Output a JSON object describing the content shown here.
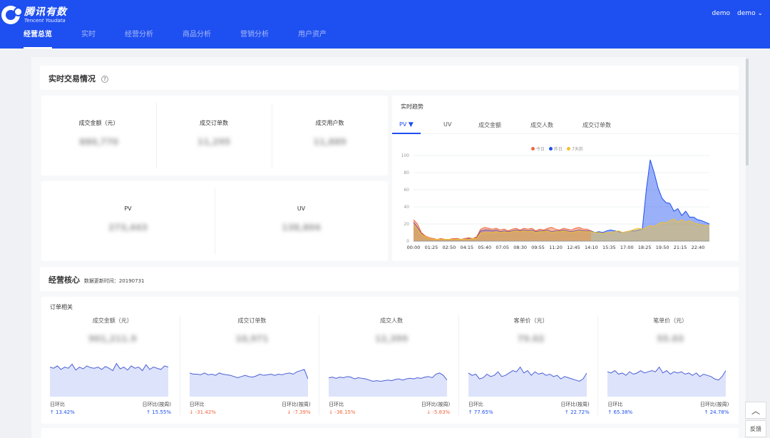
{
  "header": {
    "logo_cn": "腾讯有数",
    "logo_en": "Tencent Youdata",
    "user1": "demo",
    "user2": "demo",
    "nav": [
      "经营总览",
      "实时",
      "经营分析",
      "商品分析",
      "营销分析",
      "用户资产"
    ]
  },
  "realtime": {
    "title": "实时交易情况",
    "help": "?",
    "kpis_top": [
      {
        "label": "成交金额（元）",
        "value": "880,770"
      },
      {
        "label": "成交订单数",
        "value": "11,295"
      },
      {
        "label": "成交用户数",
        "value": "11,889"
      }
    ],
    "kpis_bottom": [
      {
        "label": "PV",
        "value": "273,443"
      },
      {
        "label": "UV",
        "value": "138,804"
      }
    ]
  },
  "trend": {
    "title": "实时趋势",
    "tabs": [
      "PV",
      "UV",
      "成交金额",
      "成交人数",
      "成交订单数"
    ],
    "legend": [
      "今日",
      "昨日",
      "7天前"
    ]
  },
  "colors": {
    "header": "#1e4ff0",
    "today": "#f0673f",
    "yesterday": "#1e4ff0",
    "week_ago": "#f2c12e",
    "up": "#1e4ff0",
    "down": "#f0673f"
  },
  "chart_data": {
    "type": "area",
    "x_ticks": [
      "00:00",
      "01:25",
      "02:50",
      "04:15",
      "05:40",
      "07:05",
      "08:30",
      "09:55",
      "11:20",
      "12:45",
      "14:10",
      "15:35",
      "17:00",
      "18:25",
      "19:50",
      "21:15",
      "22:40"
    ],
    "y_ticks": [
      0,
      20,
      40,
      60,
      80,
      100
    ],
    "ylim": [
      0,
      100
    ],
    "series": [
      {
        "name": "今日",
        "color": "#f0673f",
        "values": [
          25,
          20,
          10,
          6,
          4,
          3,
          2,
          3,
          2,
          2,
          3,
          3,
          2,
          3,
          4,
          3,
          5,
          14,
          16,
          15,
          14,
          15,
          13,
          14,
          12,
          14,
          15,
          13,
          15,
          14,
          15,
          12,
          14,
          13,
          15,
          16,
          14,
          13,
          15,
          14,
          13,
          15,
          16,
          14,
          14,
          12
        ]
      },
      {
        "name": "昨日",
        "color": "#1e4ff0",
        "values": [
          22,
          16,
          9,
          5,
          3,
          2,
          2,
          2,
          2,
          2,
          2,
          3,
          2,
          2,
          3,
          3,
          4,
          12,
          13,
          13,
          12,
          13,
          11,
          12,
          11,
          12,
          13,
          12,
          13,
          12,
          13,
          11,
          12,
          12,
          13,
          11,
          12,
          12,
          13,
          12,
          11,
          12,
          13,
          12,
          12,
          12,
          10,
          11,
          10,
          12,
          13,
          12,
          11,
          10,
          11,
          12,
          12,
          13,
          14,
          60,
          95,
          80,
          62,
          50,
          45,
          44,
          35,
          38,
          30,
          35,
          28,
          28,
          25,
          24,
          22,
          20
        ]
      },
      {
        "name": "7天前",
        "color": "#f2c12e",
        "values": [
          20,
          14,
          8,
          5,
          3,
          2,
          2,
          2,
          2,
          2,
          2,
          2,
          2,
          2,
          2,
          3,
          3,
          9,
          10,
          10,
          10,
          11,
          10,
          11,
          10,
          11,
          12,
          11,
          12,
          11,
          12,
          10,
          11,
          11,
          12,
          10,
          11,
          11,
          12,
          11,
          10,
          11,
          12,
          11,
          11,
          11,
          10,
          10,
          9,
          10,
          10,
          11,
          12,
          10,
          11,
          12,
          14,
          15,
          14,
          16,
          18,
          17,
          20,
          22,
          21,
          24,
          26,
          22,
          25,
          22,
          24,
          21,
          20,
          19,
          18,
          18
        ]
      }
    ]
  },
  "core": {
    "title": "经营核心",
    "update_label": "数据更新时间：",
    "update_date": "20190731"
  },
  "orders": {
    "title": "订单相关",
    "cards": [
      {
        "title": "成交金额（元）",
        "value": "901,211.9",
        "dod_label": "日环比",
        "dod": "13.42%",
        "dod_dir": "up",
        "wow_label": "日环比(按周)",
        "wow": "15.55%",
        "wow_dir": "up",
        "spark": [
          50,
          48,
          52,
          46,
          50,
          48,
          55,
          45,
          50,
          47,
          52,
          49,
          48,
          50,
          46,
          51,
          48,
          44,
          56,
          47,
          50,
          45,
          52,
          48,
          50,
          44,
          54,
          46,
          50,
          48,
          46,
          52,
          50
        ]
      },
      {
        "title": "成交订单数",
        "value": "10,971",
        "dod_label": "日环比",
        "dod": "-31.42%",
        "dod_dir": "down",
        "wow_label": "日环比(按周)",
        "wow": "-7.39%",
        "wow_dir": "down",
        "spark": [
          40,
          38,
          38,
          37,
          40,
          37,
          38,
          36,
          40,
          38,
          37,
          36,
          34,
          32,
          34,
          36,
          34,
          33,
          35,
          38,
          36,
          37,
          38,
          36,
          38,
          37,
          39,
          40,
          38,
          42,
          44,
          46,
          30
        ]
      },
      {
        "title": "成交人数",
        "value": "12,399",
        "dod_label": "日环比",
        "dod": "-36.15%",
        "dod_dir": "down",
        "wow_label": "日环比(按周)",
        "wow": "-5.83%",
        "wow_dir": "down",
        "spark": [
          32,
          33,
          31,
          33,
          32,
          34,
          33,
          30,
          32,
          31,
          30,
          28,
          26,
          27,
          26,
          27,
          28,
          27,
          29,
          30,
          28,
          30,
          31,
          30,
          32,
          31,
          33,
          34,
          32,
          38,
          40,
          36,
          28
        ]
      },
      {
        "title": "客单价（元）",
        "value": "79.02",
        "dod_label": "日环比",
        "dod": "77.65%",
        "dod_dir": "up",
        "wow_label": "日环比(按周)",
        "wow": "22.72%",
        "wow_dir": "up",
        "spark": [
          40,
          36,
          38,
          30,
          32,
          38,
          34,
          36,
          42,
          34,
          36,
          40,
          44,
          42,
          50,
          40,
          44,
          36,
          42,
          38,
          40,
          36,
          38,
          34,
          36,
          30,
          34,
          32,
          30,
          28,
          26,
          30,
          40
        ]
      },
      {
        "title": "笔单价（元）",
        "value": "55.03",
        "dod_label": "日环比",
        "dod": "65.38%",
        "dod_dir": "up",
        "wow_label": "日环比(按周)",
        "wow": "24.78%",
        "wow_dir": "up",
        "spark": [
          42,
          40,
          44,
          38,
          40,
          36,
          42,
          38,
          40,
          44,
          40,
          42,
          44,
          42,
          50,
          40,
          44,
          38,
          42,
          40,
          42,
          38,
          40,
          36,
          40,
          34,
          38,
          36,
          34,
          30,
          28,
          34,
          44
        ]
      }
    ]
  },
  "float": {
    "top_icon": "chevron-up-icon",
    "feedback": "反馈"
  }
}
